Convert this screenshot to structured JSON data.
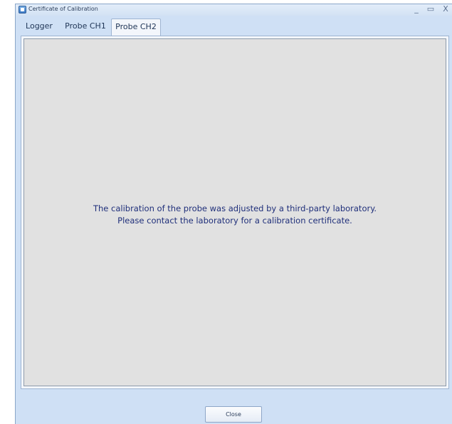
{
  "window": {
    "title": "Certificate of Calibration",
    "minimize_glyph": "_",
    "maximize_glyph": "▭",
    "close_glyph": "X"
  },
  "tabs": [
    {
      "label": "Logger",
      "active": false
    },
    {
      "label": "Probe CH1",
      "active": false
    },
    {
      "label": "Probe CH2",
      "active": true
    }
  ],
  "panel": {
    "message_line1": "The calibration of the probe was adjusted by a third-party laboratory.",
    "message_line2": "Please contact the laboratory for a calibration certificate."
  },
  "footer": {
    "close_label": "Close"
  },
  "colors": {
    "window_frame": "#cfe0f5",
    "panel_background": "#e1e1e1",
    "message_text": "#1f2f7a"
  },
  "icons": {
    "app": "app-icon"
  }
}
